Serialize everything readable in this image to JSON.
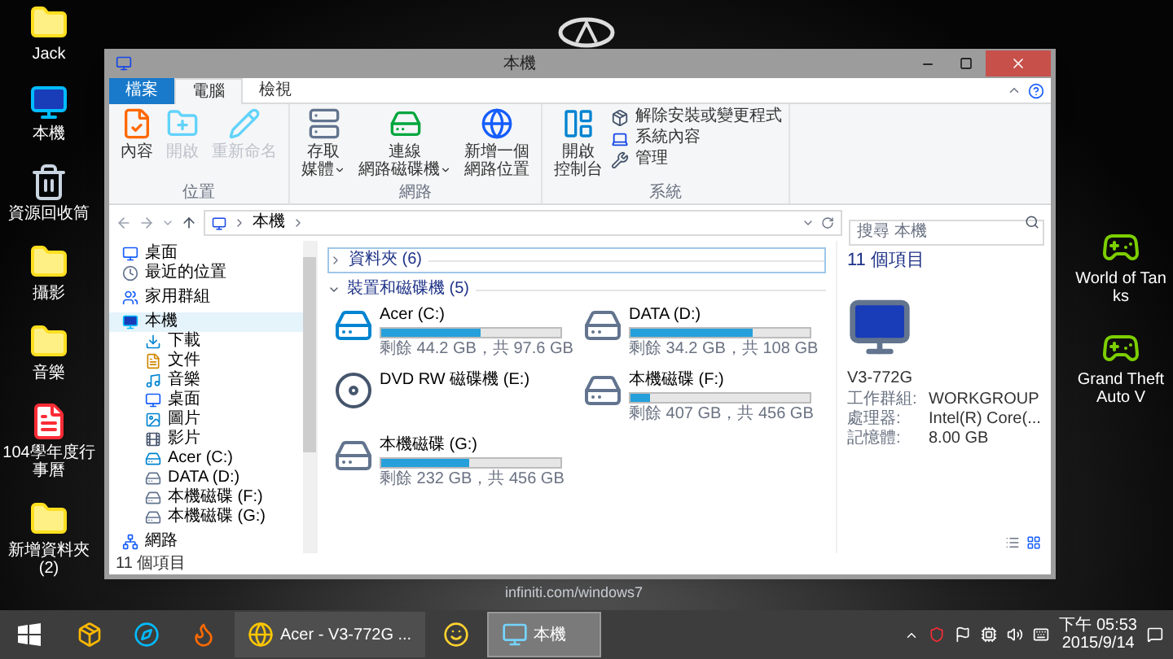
{
  "wallpaper": {
    "caption": "infiniti.com/windows7"
  },
  "desktop_left": [
    {
      "label": "Jack",
      "kind": "user-folder"
    },
    {
      "label": "本機",
      "kind": "computer"
    },
    {
      "label": "資源回收筒",
      "kind": "recycle"
    },
    {
      "label": "攝影",
      "kind": "folder"
    },
    {
      "label": "音樂",
      "kind": "folder"
    },
    {
      "label": "104學年度行事曆",
      "kind": "pdf"
    },
    {
      "label": "新增資料夾 (2)",
      "kind": "folder"
    }
  ],
  "desktop_right": [
    {
      "label": "World of Tanks",
      "kind": "game"
    },
    {
      "label": "Grand Theft Auto V",
      "kind": "game"
    }
  ],
  "window": {
    "title": "本機",
    "tabs": [
      {
        "label": "檔案",
        "kind": "file",
        "selected": false
      },
      {
        "label": "電腦",
        "kind": "tab",
        "selected": true
      },
      {
        "label": "檢視",
        "kind": "tab",
        "selected": false
      }
    ],
    "ribbon_groups": [
      {
        "label": "位置",
        "large_buttons": [
          {
            "lines": [
              "內容"
            ],
            "kind": "properties",
            "disabled": false,
            "dropdown": false
          },
          {
            "lines": [
              "開啟"
            ],
            "kind": "open",
            "disabled": true,
            "dropdown": false
          },
          {
            "lines": [
              "重新命名"
            ],
            "kind": "rename",
            "disabled": true,
            "dropdown": false
          }
        ]
      },
      {
        "label": "網路",
        "large_buttons": [
          {
            "lines": [
              "存取",
              "媒體"
            ],
            "kind": "media",
            "disabled": false,
            "dropdown": true
          },
          {
            "lines": [
              "連線",
              "網路磁碟機"
            ],
            "kind": "map-drive",
            "disabled": false,
            "dropdown": true
          },
          {
            "lines": [
              "新增一個",
              "網路位置"
            ],
            "kind": "add-location",
            "disabled": false,
            "dropdown": false
          }
        ]
      },
      {
        "label": "系統",
        "large_buttons": [
          {
            "lines": [
              "開啟",
              "控制台"
            ],
            "kind": "control-panel",
            "disabled": false,
            "dropdown": false
          }
        ],
        "small_buttons": [
          {
            "lines": [
              "解除安裝或變更程式"
            ],
            "kind": "uninstall",
            "disabled": false,
            "dropdown": false
          },
          {
            "lines": [
              "系統內容"
            ],
            "kind": "system-properties",
            "disabled": false,
            "dropdown": false
          },
          {
            "lines": [
              "管理"
            ],
            "kind": "manage",
            "disabled": false,
            "dropdown": false
          }
        ]
      }
    ],
    "address": "本機",
    "search": {
      "placeholder": "搜尋 本機"
    },
    "nav": [
      {
        "label": "桌面",
        "kind": "desktop",
        "selected": false
      },
      {
        "label": "最近的位置",
        "kind": "recent",
        "selected": false
      },
      {
        "label": "家用群組",
        "kind": "homegroup",
        "selected": false
      },
      {
        "label": "本機",
        "kind": "computer",
        "selected": true,
        "children": [
          {
            "label": "下載",
            "kind": "downloads",
            "selected": false
          },
          {
            "label": "文件",
            "kind": "documents",
            "selected": false
          },
          {
            "label": "音樂",
            "kind": "music",
            "selected": false
          },
          {
            "label": "桌面",
            "kind": "desktop",
            "selected": false
          },
          {
            "label": "圖片",
            "kind": "pictures",
            "selected": false
          },
          {
            "label": "影片",
            "kind": "videos",
            "selected": false
          },
          {
            "label": "Acer (C:)",
            "kind": "system-drive",
            "selected": false
          },
          {
            "label": "DATA (D:)",
            "kind": "drive",
            "selected": false
          },
          {
            "label": "本機磁碟 (F:)",
            "kind": "drive",
            "selected": false
          },
          {
            "label": "本機磁碟 (G:)",
            "kind": "drive",
            "selected": false
          }
        ]
      },
      {
        "label": "網路",
        "kind": "network",
        "selected": false
      }
    ],
    "groups": [
      {
        "label": "資料夾 (6)",
        "expanded": false
      },
      {
        "label": "裝置和磁碟機 (5)",
        "expanded": true
      }
    ],
    "drives": [
      {
        "name": "Acer (C:)",
        "kind": "system",
        "level": 0.55,
        "reading": "剩餘 44.2 GB，共 97.6 GB"
      },
      {
        "name": "DATA (D:)",
        "kind": "hdd",
        "level": 0.68,
        "reading": "剩餘 34.2 GB，共 108 GB"
      },
      {
        "name": "DVD RW 磁碟機 (E:)",
        "kind": "dvd"
      },
      {
        "name": "本機磁碟 (F:)",
        "kind": "hdd",
        "level": 0.11,
        "reading": "剩餘 407 GB，共 456 GB"
      },
      {
        "name": "本機磁碟 (G:)",
        "kind": "hdd",
        "level": 0.49,
        "reading": "剩餘 232 GB，共 456 GB"
      }
    ],
    "details": {
      "count": "11 個項目",
      "computer_name": "V3-772G",
      "rows": [
        {
          "label": "工作群組:",
          "value": "WORKGROUP"
        },
        {
          "label": "處理器:",
          "value": "Intel(R) Core(..."
        },
        {
          "label": "記憶體:",
          "value": "8.00 GB"
        }
      ]
    },
    "status": "11 個項目"
  },
  "taskbar": {
    "items": [
      {
        "kind": "start",
        "selected": false
      },
      {
        "kind": "app",
        "selected": false
      },
      {
        "kind": "ie",
        "selected": false
      },
      {
        "kind": "firefox",
        "selected": false
      },
      {
        "kind": "chrome",
        "label": "Acer - V3-772G ...",
        "selected": false
      },
      {
        "kind": "smiley",
        "selected": false
      },
      {
        "kind": "explorer",
        "label": "本機",
        "selected": true
      }
    ],
    "time": "下午 05:53",
    "date": "2015/9/14"
  }
}
